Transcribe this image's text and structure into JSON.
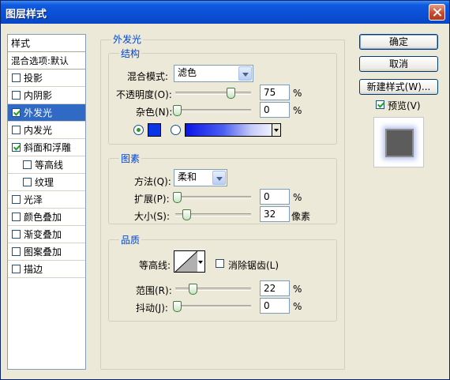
{
  "window": {
    "title": "图层样式"
  },
  "style_list": {
    "header": "样式",
    "blend_options": "混合选项:默认",
    "items": [
      {
        "label": "投影",
        "checked": false,
        "selected": false,
        "sub": false
      },
      {
        "label": "内阴影",
        "checked": false,
        "selected": false,
        "sub": false
      },
      {
        "label": "外发光",
        "checked": true,
        "selected": true,
        "sub": false
      },
      {
        "label": "内发光",
        "checked": false,
        "selected": false,
        "sub": false
      },
      {
        "label": "斜面和浮雕",
        "checked": true,
        "selected": false,
        "sub": false
      },
      {
        "label": "等高线",
        "checked": false,
        "selected": false,
        "sub": true
      },
      {
        "label": "纹理",
        "checked": false,
        "selected": false,
        "sub": true
      },
      {
        "label": "光泽",
        "checked": false,
        "selected": false,
        "sub": false
      },
      {
        "label": "颜色叠加",
        "checked": false,
        "selected": false,
        "sub": false
      },
      {
        "label": "渐变叠加",
        "checked": false,
        "selected": false,
        "sub": false
      },
      {
        "label": "图案叠加",
        "checked": false,
        "selected": false,
        "sub": false
      },
      {
        "label": "描边",
        "checked": false,
        "selected": false,
        "sub": false
      }
    ]
  },
  "outer_glow": {
    "title": "外发光",
    "structure": {
      "title": "结构",
      "blend_mode_label": "混合模式:",
      "blend_mode_value": "滤色",
      "opacity_label": "不透明度(O):",
      "opacity_value": "75",
      "opacity_level": 0.75,
      "noise_label": "杂色(N):",
      "noise_value": "0",
      "noise_level": 0,
      "pct": "%",
      "color": "#0a35e6"
    },
    "elements": {
      "title": "图素",
      "method_label": "方法(Q):",
      "method_value": "柔和",
      "spread_label": "扩展(P):",
      "spread_value": "0",
      "spread_level": 0,
      "size_label": "大小(S):",
      "size_value": "32",
      "size_level": 0.13,
      "size_unit": "像素",
      "pct": "%"
    },
    "quality": {
      "title": "品质",
      "contour_label": "等高线:",
      "antialias_label": "消除锯齿(L)",
      "range_label": "范围(R):",
      "range_value": "22",
      "range_level": 0.22,
      "jitter_label": "抖动(J):",
      "jitter_value": "0",
      "jitter_level": 0,
      "pct": "%"
    }
  },
  "buttons": {
    "ok": "确定",
    "cancel": "取消",
    "new_style": "新建样式(W)...",
    "preview": "预览(V)"
  }
}
